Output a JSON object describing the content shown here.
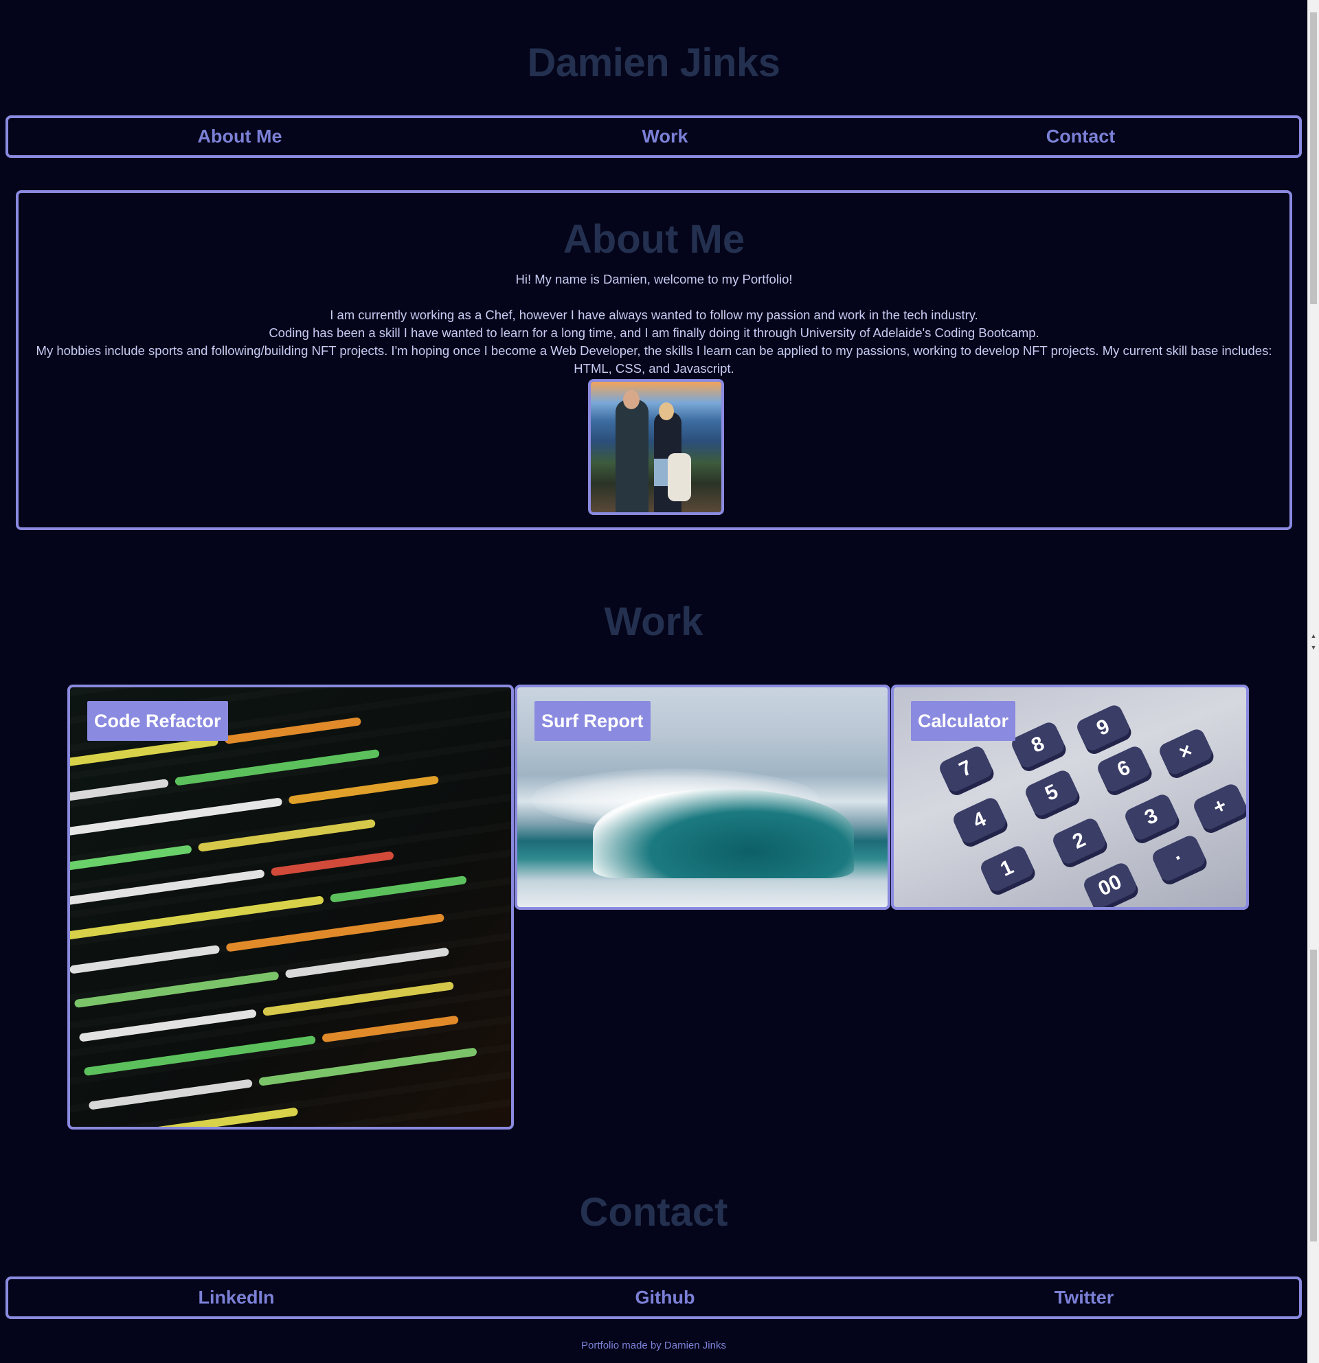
{
  "header": {
    "title": "Damien Jinks"
  },
  "nav": {
    "items": [
      "About Me",
      "Work",
      "Contact"
    ]
  },
  "about": {
    "title": "About Me",
    "intro": "Hi! My name is Damien, welcome to my Portfolio!",
    "line1": "I am currently working as a Chef, however I have always wanted to follow my passion and work in the tech industry.",
    "line2": "Coding has been a skill I have wanted to learn for a long time, and I am finally doing it through University of Adelaide's Coding Bootcamp.",
    "line3": "My hobbies include sports and following/building NFT projects. I'm hoping once I become a Web Developer, the skills I learn can be applied to my passions, working to develop NFT projects. My current skill base includes: HTML, CSS, and Javascript."
  },
  "work": {
    "title": "Work",
    "projects": [
      {
        "label": "Code Refactor"
      },
      {
        "label": "Surf Report"
      },
      {
        "label": "Calculator"
      }
    ]
  },
  "contact": {
    "title": "Contact",
    "links": [
      "LinkedIn",
      "Github",
      "Twitter"
    ]
  },
  "footer": {
    "text": "Portfolio made by Damien Jinks"
  },
  "colors": {
    "background": "#04051a",
    "accent": "#8a8ae0",
    "heading": "#24304f",
    "link": "#7b80d6"
  }
}
